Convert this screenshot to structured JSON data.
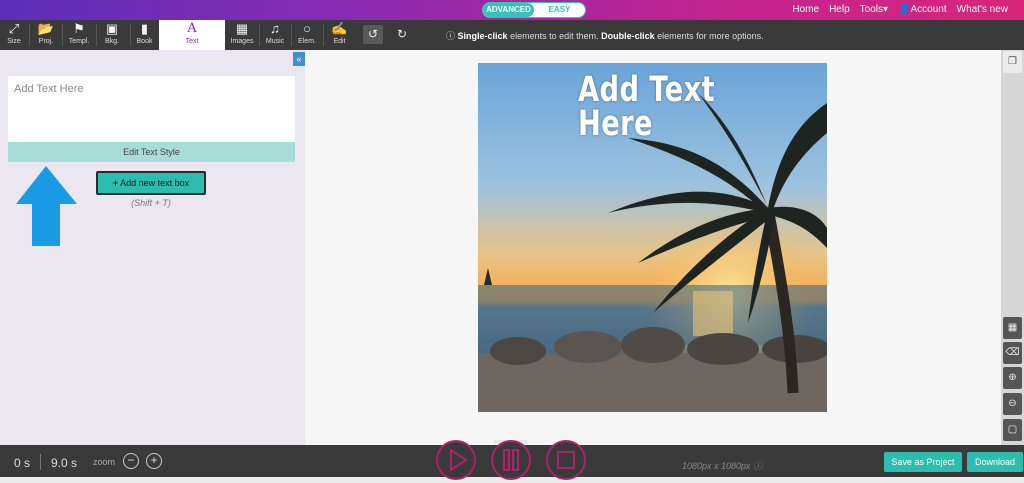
{
  "topbar": {
    "mode_advanced": "ADVANCED",
    "mode_easy": "EASY",
    "nav": {
      "home": "Home",
      "help": "Help",
      "tools": "Tools▾",
      "account": "Account",
      "whats_new": "What's new"
    }
  },
  "toolbar": {
    "tools": [
      {
        "label": "Size",
        "icon": "resize-icon"
      },
      {
        "label": "Proj.",
        "icon": "folder-icon"
      },
      {
        "label": "Templ.",
        "icon": "bookmark-icon"
      },
      {
        "label": "Bkg.",
        "icon": "background-icon"
      },
      {
        "label": "Book",
        "icon": "book-icon"
      },
      {
        "label": "Text",
        "icon": "text-icon"
      },
      {
        "label": "Images",
        "icon": "image-icon"
      },
      {
        "label": "Music",
        "icon": "music-icon"
      },
      {
        "label": "Elem.",
        "icon": "circle-icon"
      },
      {
        "label": "Edit",
        "icon": "paint-roller-icon"
      }
    ],
    "hint_strong1": "Single-click",
    "hint_mid": " elements to edit them. ",
    "hint_strong2": "Double-click",
    "hint_end": " elements for more options."
  },
  "left_panel": {
    "textarea_placeholder": "Add Text Here",
    "edit_style_label": "Edit Text Style",
    "add_text_label": "Add new text box",
    "shortcut": "(Shift + T)"
  },
  "canvas": {
    "text": "Add Text Here",
    "text_line1": "Add Text",
    "text_line2": "Here"
  },
  "bottom": {
    "start_time": "0 s",
    "end_time": "9.0 s",
    "zoom_label": "zoom",
    "dims": "1080px x 1080px",
    "save_label": "Save as Project",
    "download_label": "Download"
  },
  "colors": {
    "accent": "#2dbdae",
    "brand": "#8a2bb0",
    "play_ring": "#b0206c"
  }
}
